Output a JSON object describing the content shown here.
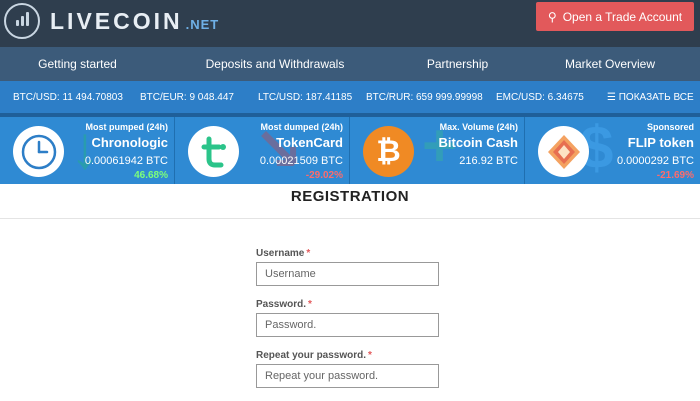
{
  "header": {
    "logo_text": "LIVECOIN",
    "logo_suffix": ".NET",
    "trade_button": "Open a Trade Account",
    "trade_icon": "user-key-icon"
  },
  "nav": {
    "items": [
      "Getting started",
      "Deposits and Withdrawals",
      "Partnership",
      "Market Overview"
    ]
  },
  "ticker": {
    "items": [
      "BTC/USD: 11 494.70803",
      "BTC/EUR: 9 048.447",
      "LTC/USD: 187.41185",
      "BTC/RUR: 659 999.99998",
      "EMC/USD: 6.34675"
    ],
    "show_all": "☰ ПОКАЗАТЬ ВСЕ"
  },
  "cards": [
    {
      "label": "Most pumped (24h)",
      "name": "Chronologic",
      "price": "0.00061942 BTC",
      "change": "46.68%",
      "change_color": "#7dff7a",
      "icon": "clock-icon"
    },
    {
      "label": "Most dumped (24h)",
      "name": "TokenCard",
      "price": "0.00021509 BTC",
      "change": "-29.02%",
      "change_color": "#ff6b6b",
      "icon": "tokencard-icon"
    },
    {
      "label": "Max. Volume (24h)",
      "name": "Bitcoin Cash",
      "price": "216.92 BTC",
      "change": "",
      "change_color": "#ffffff",
      "icon": "bitcoin-icon"
    },
    {
      "label": "Sponsored",
      "name": "FLIP token",
      "price": "0.0000292 BTC",
      "change": "-21.69%",
      "change_color": "#ff6b6b",
      "icon": "flip-token-icon"
    }
  ],
  "registration": {
    "title": "REGISTRATION",
    "fields": [
      {
        "label": "Username",
        "placeholder": "Username",
        "required": "*"
      },
      {
        "label": "Password.",
        "placeholder": "Password.",
        "required": "*"
      },
      {
        "label": "Repeat your password.",
        "placeholder": "Repeat your password.",
        "required": "*"
      }
    ]
  },
  "colors": {
    "header_bg": "#2f3e4e",
    "nav_bg": "#3c5b7a",
    "ticker_bg": "#2d7ec7",
    "card_bg": "#2f8ad3",
    "accent_red": "#e2595b"
  }
}
